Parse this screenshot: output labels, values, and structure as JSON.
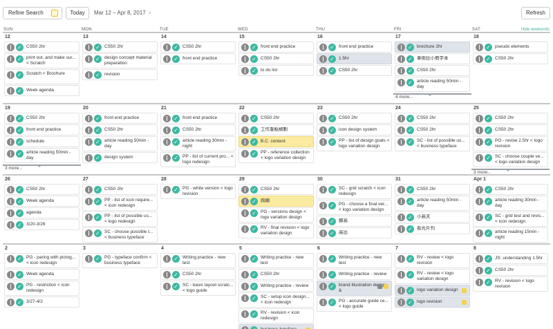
{
  "toolbar": {
    "refine_label": "Refine Search",
    "refine_icon": "filter-icon",
    "today_label": "Today",
    "range_label": "Mar 12 – Apr 8, 2017",
    "range_chevron": "˅",
    "refresh_label": "Refresh"
  },
  "hide_weekends_label": "Hide weekends",
  "days": [
    "SUN",
    "MON",
    "TUE",
    "WED",
    "THU",
    "FRI",
    "SAT"
  ],
  "colors": {
    "accent": "#3cb9a2",
    "highlight": "#faeba0",
    "selected": "#dfe4ea"
  },
  "weeks": [
    {
      "days": [
        {
          "label": "12",
          "tasks": [
            {
              "text": "CS50 2hr"
            },
            {
              "text": "print out, and make sur... < Scratch",
              "tall": true
            },
            {
              "text": "Scratch < Brochure",
              "tall": true
            },
            {
              "text": "Week agenda"
            }
          ]
        },
        {
          "label": "13",
          "tasks": [
            {
              "text": "CS50 2hr"
            },
            {
              "text": "design concept material preparation",
              "tall": true
            },
            {
              "text": "revision"
            }
          ]
        },
        {
          "label": "14",
          "tasks": [
            {
              "text": "CS50 2hr"
            },
            {
              "text": "front end practice"
            }
          ]
        },
        {
          "label": "15",
          "tasks": [
            {
              "text": "front end practice"
            },
            {
              "text": "CS50 2hr"
            },
            {
              "text": "to do list"
            }
          ]
        },
        {
          "label": "16",
          "tasks": [
            {
              "text": "front end practice"
            },
            {
              "text": "1.5hr",
              "variant": "gr"
            },
            {
              "text": "CS50 2hr"
            }
          ]
        },
        {
          "label": "17",
          "tasks": [
            {
              "text": "brochure 2hr",
              "variant": "gr"
            },
            {
              "text": "拿拖拉小冊字本"
            },
            {
              "text": "CS50 2hr"
            },
            {
              "text": "article reading 50min - day",
              "tall": true
            }
          ],
          "more": "4 more..."
        },
        {
          "label": "18",
          "tasks": [
            {
              "text": "pseudo elements"
            },
            {
              "text": "CS50 2hr"
            }
          ]
        }
      ]
    },
    {
      "days": [
        {
          "label": "19",
          "tasks": [
            {
              "text": "CS50 2hr"
            },
            {
              "text": "front end practice"
            },
            {
              "text": "schedule"
            },
            {
              "text": "article reading 50min - day",
              "tall": true
            }
          ],
          "more": "3 more..."
        },
        {
          "label": "20",
          "tasks": [
            {
              "text": "front end practice"
            },
            {
              "text": "CS50 2hr"
            },
            {
              "text": "article reading 50min - day",
              "tall": true
            },
            {
              "text": "design system"
            }
          ]
        },
        {
          "label": "21",
          "tasks": [
            {
              "text": "front end practice"
            },
            {
              "text": "CS50 2hr"
            },
            {
              "text": "article reading 30min - night",
              "tall": true
            },
            {
              "text": "PP - list of current pro... < logo redesign",
              "tall": true
            }
          ]
        },
        {
          "label": "22",
          "tasks": [
            {
              "text": "CS50 2hr"
            },
            {
              "text": "工作重點規劃"
            },
            {
              "text": "B.C. content",
              "variant": "hl"
            },
            {
              "text": "PP - reference collection < logo variation design",
              "tall": true
            }
          ]
        },
        {
          "label": "23",
          "tasks": [
            {
              "text": "CS50 2hr"
            },
            {
              "text": "icon design system"
            },
            {
              "text": "PP - list of design goals < logo variation design",
              "tall": true
            }
          ]
        },
        {
          "label": "24",
          "tasks": [
            {
              "text": "CS50 2hr"
            },
            {
              "text": "CS50 2hr"
            },
            {
              "text": "SC - list of possible us... < business typeface",
              "tall": true
            }
          ]
        },
        {
          "label": "25",
          "tasks": [
            {
              "text": "CS50 2hr"
            },
            {
              "text": "CS50 2hr"
            },
            {
              "text": "PO - revise 2.5hr < logo revision",
              "tall": true
            },
            {
              "text": "SC - choose couple ve... < logo variation design",
              "tall": true
            }
          ],
          "more": "3 more..."
        }
      ]
    },
    {
      "days": [
        {
          "label": "26",
          "tasks": [
            {
              "text": "CS50 2hr"
            },
            {
              "text": "Week agenda"
            },
            {
              "text": "agenda"
            },
            {
              "text": "3/20-3/26"
            }
          ]
        },
        {
          "label": "27",
          "tasks": [
            {
              "text": "CS50 2hr"
            },
            {
              "text": "PP - list of icon require... < icon redesign",
              "tall": true
            },
            {
              "text": "PP - list of possible us... < logo redesign",
              "tall": true
            },
            {
              "text": "SC - choose possible t... < business typeface",
              "tall": true
            }
          ]
        },
        {
          "label": "28",
          "tasks": [
            {
              "text": "PG - white version < logo revision",
              "tall": true
            }
          ]
        },
        {
          "label": "29",
          "tasks": [
            {
              "text": "CS50 2hr"
            },
            {
              "text": "跨欄",
              "variant": "hl"
            },
            {
              "text": "PG - versions design < logo variation design",
              "tall": true
            },
            {
              "text": "RV - final revision < logo variation design",
              "tall": true
            }
          ]
        },
        {
          "label": "30",
          "tasks": [
            {
              "text": "SC - grid scratch < icon redesign",
              "tall": true
            },
            {
              "text": "PG - choose a final ver... < logo variation design",
              "tall": true
            },
            {
              "text": "鄭高"
            },
            {
              "text": "高出"
            }
          ]
        },
        {
          "label": "31",
          "tasks": [
            {
              "text": "CS50 2hr"
            },
            {
              "text": "article reading 50min - day",
              "tall": true
            },
            {
              "text": "小高夫"
            },
            {
              "text": "看光片刊"
            }
          ]
        },
        {
          "label": "Apr 1",
          "tasks": [
            {
              "text": "CS50 2hr"
            },
            {
              "text": "article reading 30min - day",
              "tall": true
            },
            {
              "text": "SC - grid test and revis... < icon redesign",
              "tall": true
            },
            {
              "text": "article reading 15min - night",
              "tall": true
            }
          ],
          "more": "1 more..."
        }
      ]
    },
    {
      "days": [
        {
          "label": "2",
          "tasks": [
            {
              "text": "PG - paring with pictog... < icon redesign",
              "tall": true
            },
            {
              "text": "Week agenda"
            },
            {
              "text": "PG - restriction < icon redesign",
              "tall": true
            },
            {
              "text": "3/27-4/2"
            }
          ]
        },
        {
          "label": "3",
          "tasks": [
            {
              "text": "PG - typeface confirm < business typeface",
              "tall": true
            }
          ]
        },
        {
          "label": "4",
          "tasks": [
            {
              "text": "Writing practice - new test",
              "tall": true
            },
            {
              "text": "CS50 2hr"
            },
            {
              "text": "SC - basic layout scratc... < logo guide",
              "tall": true
            }
          ]
        },
        {
          "label": "5",
          "tasks": [
            {
              "text": "Writing practice - new test",
              "tall": true
            },
            {
              "text": "CS50 2hr"
            },
            {
              "text": "Writing practice - review"
            },
            {
              "text": "SC - setup icon design... < icon redesign",
              "tall": true
            },
            {
              "text": "RV - revision < icon redesign",
              "tall": true
            },
            {
              "text": "business typeface",
              "variant": "gr",
              "marker": "yellow"
            }
          ]
        },
        {
          "label": "6",
          "tasks": [
            {
              "text": "Writing practice - new test",
              "tall": true
            },
            {
              "text": "Writing practice - review"
            },
            {
              "text": "brand illustration design &",
              "tall": true,
              "variant": "gr",
              "marker": "both"
            },
            {
              "text": "PG - accurate guide ce... < logo guide",
              "tall": true
            }
          ]
        },
        {
          "label": "7",
          "tasks": [
            {
              "text": "RV - review < logo revision",
              "tall": true
            },
            {
              "text": "RV - review < logo variation design",
              "tall": true
            },
            {
              "text": "logo variation design",
              "variant": "gr",
              "marker": "yellow"
            },
            {
              "text": "logo revision",
              "variant": "gr",
              "marker": "yellow"
            }
          ]
        },
        {
          "label": "8",
          "tasks": [
            {
              "text": "JS: understanding 1.5hr"
            },
            {
              "text": "CS50 2hr"
            },
            {
              "text": "RV - revision < logo revision",
              "tall": true
            }
          ]
        }
      ]
    }
  ]
}
